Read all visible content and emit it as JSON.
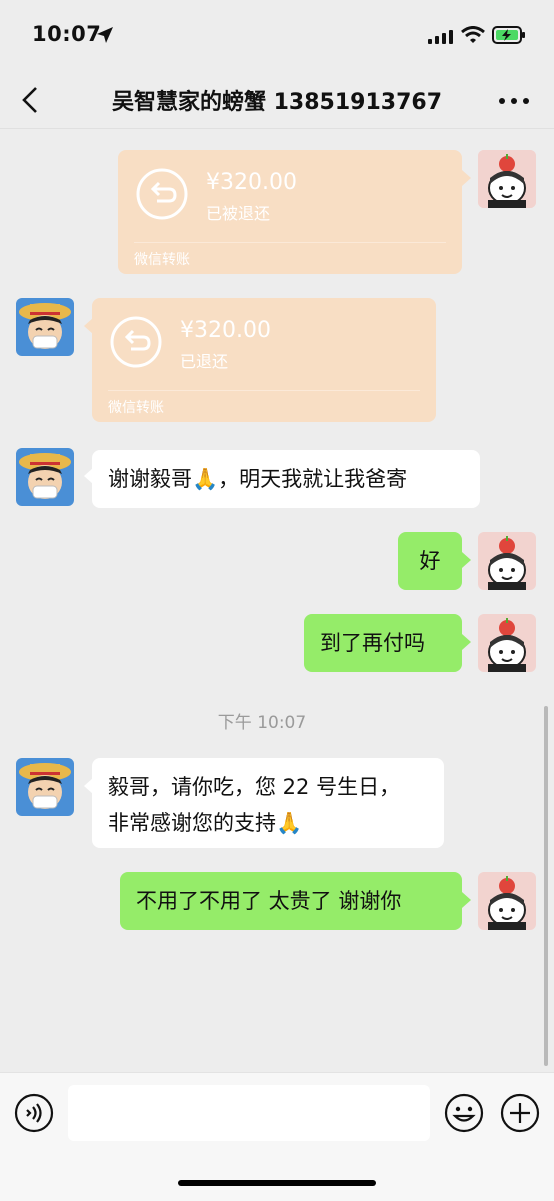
{
  "status_bar": {
    "time": "10:07"
  },
  "header": {
    "title": "吴智慧家的螃蟹 13851913767"
  },
  "messages": [
    {
      "type": "transfer",
      "side": "right",
      "amount": "¥320.00",
      "status": "已被退还",
      "footer": "微信转账"
    },
    {
      "type": "transfer",
      "side": "left",
      "amount": "¥320.00",
      "status": "已退还",
      "footer": "微信转账"
    },
    {
      "type": "text",
      "side": "left",
      "text": "谢谢毅哥🙏，明天我就让我爸寄"
    },
    {
      "type": "text",
      "side": "right",
      "text": "好"
    },
    {
      "type": "text",
      "side": "right",
      "text": "到了再付吗"
    },
    {
      "type": "time",
      "text": "下午 10:07"
    },
    {
      "type": "text",
      "side": "left",
      "lines": [
        "毅哥，请你吃，您 22 号生日，",
        "非常感谢您的支持🙏"
      ]
    },
    {
      "type": "text",
      "side": "right",
      "text": "不用了不用了 太贵了 谢谢你"
    }
  ],
  "input_bar": {
    "value": "",
    "placeholder": ""
  },
  "icons": {
    "back": "chevron-left-icon",
    "more": "more-icon",
    "voice": "voice-icon",
    "emoji": "emoji-icon",
    "plus": "plus-icon",
    "transfer": "return-arrow-icon"
  },
  "colors": {
    "background": "#ededed",
    "green_bubble": "#95ec69",
    "transfer_bubble": "#f8dec4"
  }
}
